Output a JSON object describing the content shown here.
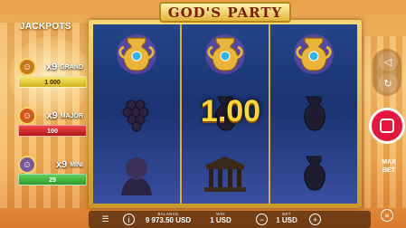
{
  "title": "GOD'S PARTY",
  "jackpots": {
    "title": "JACKPOTS",
    "tiers": [
      {
        "multiplier": "x9",
        "name": "GRAND",
        "value": "1 000",
        "color": "#d2b41c"
      },
      {
        "multiplier": "x9",
        "name": "MAJOR",
        "value": "100",
        "color": "#b21818"
      },
      {
        "multiplier": "x9",
        "name": "MINI",
        "value": "25",
        "color": "#2f9c2a"
      }
    ]
  },
  "reels": [
    [
      "golden-amphora",
      "dark-grapes",
      "dark-zeus"
    ],
    [
      "golden-amphora",
      "dark-vase",
      "dark-temple"
    ],
    [
      "golden-amphora",
      "dark-vase",
      "dark-vase"
    ]
  ],
  "win_amount": "1.00",
  "controls": {
    "max_bet_label": "MAX\nBET"
  },
  "bottom": {
    "balance_label": "BALANCE",
    "balance_value": "9 973.50 USD",
    "win_label": "WIN",
    "win_value": "1 USD",
    "bet_label": "BET",
    "bet_value": "1 USD"
  },
  "colors": {
    "spin_button": "#e6163e",
    "win_text": "#ffd534",
    "reel_bg": "#1b3370",
    "frame_gold": "#d9ad3a"
  }
}
